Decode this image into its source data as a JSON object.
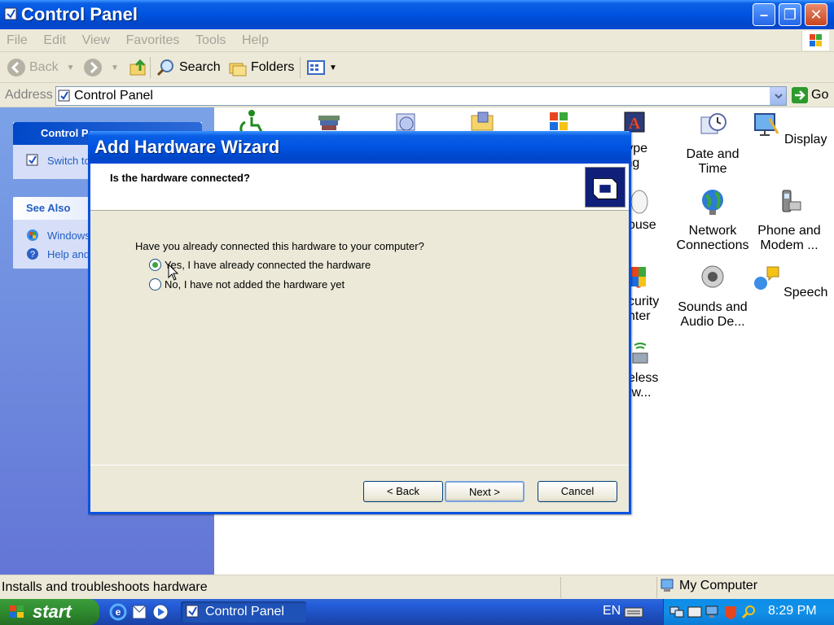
{
  "window": {
    "title": "Control Panel"
  },
  "menu": {
    "items": [
      "File",
      "Edit",
      "View",
      "Favorites",
      "Tools",
      "Help"
    ]
  },
  "toolbar": {
    "back_label": "Back",
    "search_label": "Search",
    "folders_label": "Folders"
  },
  "address": {
    "label": "Address",
    "value": "Control Panel",
    "go_label": "Go"
  },
  "taskpane": {
    "panel_title": "Control P",
    "switch_label": "Switch to",
    "see_also_title": "See Also",
    "see_also_items": [
      "Windows",
      "Help and"
    ]
  },
  "content": {
    "items": [
      {
        "label": "rType\nning"
      },
      {
        "label": "Date and\nTime"
      },
      {
        "label": "Display"
      },
      {
        "label": "ouse"
      },
      {
        "label": "Network\nConnections"
      },
      {
        "label": "Phone and\nModem ..."
      },
      {
        "label": "curity\nnter"
      },
      {
        "label": "Sounds and\nAudio De..."
      },
      {
        "label": "Speech"
      },
      {
        "label": "eless\ntw..."
      }
    ]
  },
  "status": {
    "text": "Installs and troubleshoots hardware",
    "zone": "My Computer"
  },
  "dialog": {
    "title": "Add Hardware Wizard",
    "heading": "Is the hardware connected?",
    "question": "Have you already connected this hardware to your computer?",
    "options": [
      {
        "label": "Yes, I have already connected the hardware",
        "checked": true
      },
      {
        "label": "No, I have not added the hardware yet",
        "checked": false
      }
    ],
    "back_label": "< Back",
    "next_label": "Next >",
    "cancel_label": "Cancel"
  },
  "taskbar": {
    "start_label": "start",
    "task_label": "Control Panel",
    "lang": "EN",
    "clock": "8:29 PM"
  }
}
